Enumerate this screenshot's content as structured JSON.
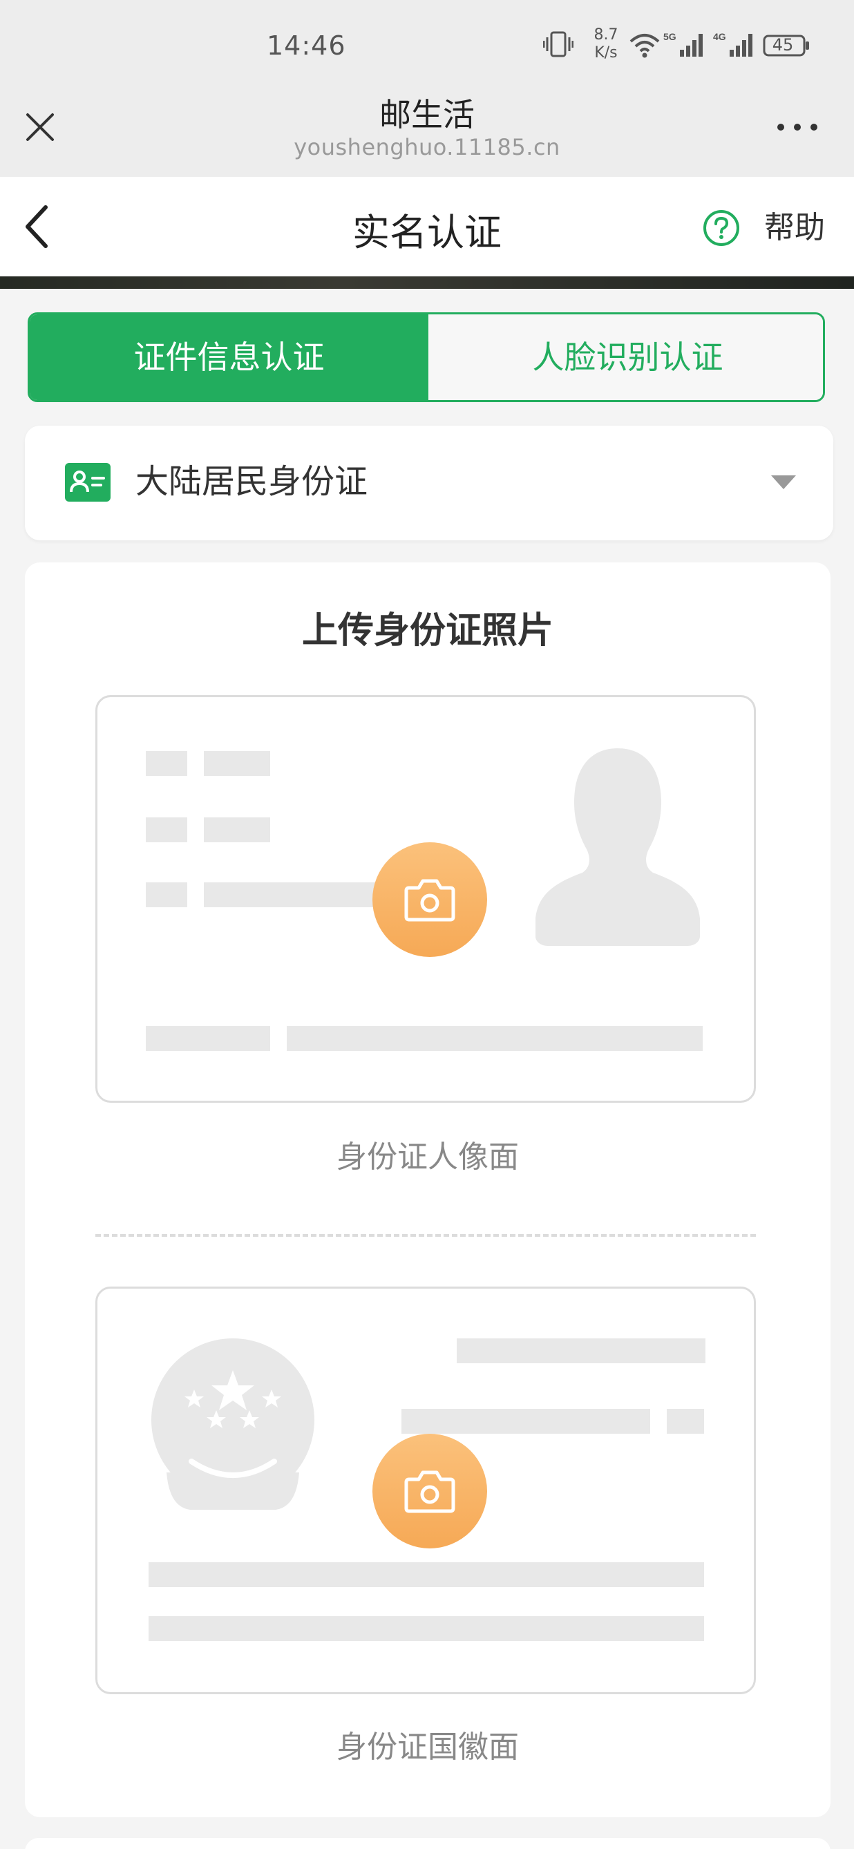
{
  "status_bar": {
    "time": "14:46",
    "net_speed_value": "8.7",
    "net_speed_unit": "K/s",
    "signal_5g": "5G",
    "signal_4g": "4G",
    "battery": "45"
  },
  "browser": {
    "title": "邮生活",
    "url": "youshenghuo.11185.cn"
  },
  "header": {
    "title": "实名认证",
    "help_label": "帮助"
  },
  "tabs": [
    {
      "label": "证件信息认证",
      "active": true
    },
    {
      "label": "人脸识别认证",
      "active": false
    }
  ],
  "id_select": {
    "value": "大陆居民身份证"
  },
  "upload": {
    "title": "上传身份证照片",
    "front_caption": "身份证人像面",
    "back_caption": "身份证国徽面"
  },
  "colors": {
    "brand_green": "#22ad5e",
    "camera_orange": "#f7ae5d",
    "placeholder_gray": "#e8e8e8"
  }
}
